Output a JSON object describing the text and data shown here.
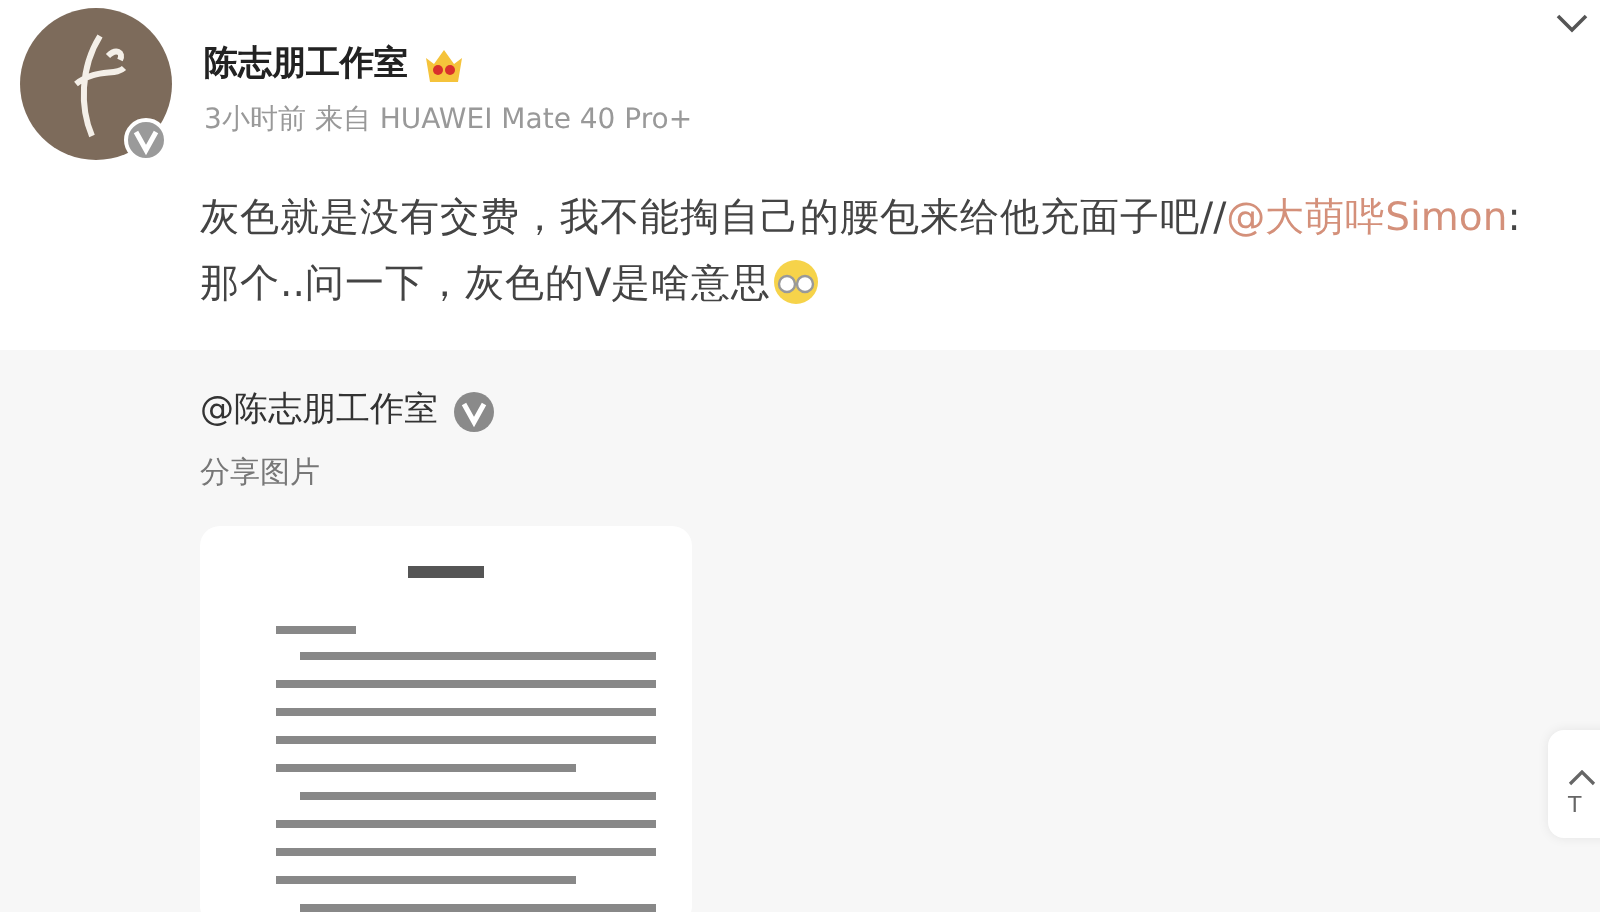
{
  "author": {
    "name": "陈志朋工作室",
    "time": "3小时前",
    "source": "来自 HUAWEI Mate 40 Pro+"
  },
  "post": {
    "text": "灰色就是没有交费，我不能掏自己的腰包来给他充面子吧//",
    "mention": "@大萌哔Simon",
    "quoted_text": ":\n那个..问一下，灰色的V是啥意思"
  },
  "repost": {
    "author": "@陈志朋工作室",
    "text": "分享图片"
  },
  "floating_button": {
    "label": "T"
  }
}
